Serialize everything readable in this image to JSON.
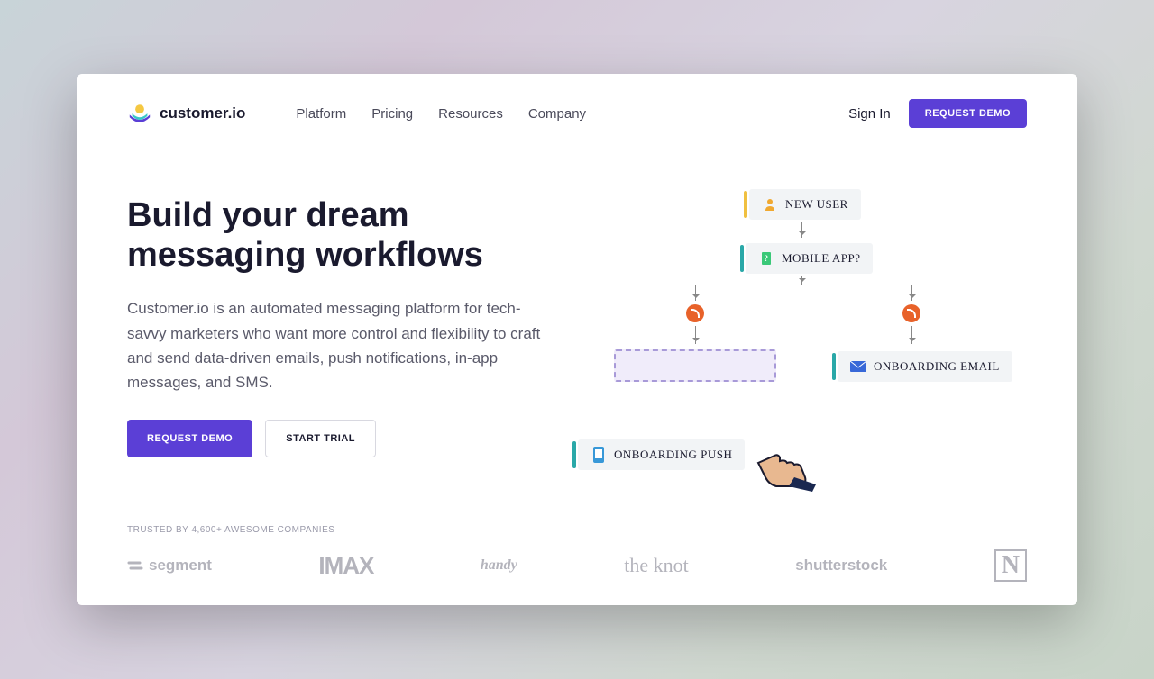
{
  "brand": {
    "name": "customer.io"
  },
  "nav": {
    "items": [
      "Platform",
      "Pricing",
      "Resources",
      "Company"
    ]
  },
  "header": {
    "signin": "Sign In",
    "request_demo": "REQUEST DEMO"
  },
  "hero": {
    "headline_line1": "Build your dream",
    "headline_line2": "messaging workflows",
    "subhead": "Customer.io is an automated messaging platform for tech-savvy marketers who want more control and flexibility to craft and send data-driven emails, push notifications, in-app messages, and SMS.",
    "cta_primary": "REQUEST DEMO",
    "cta_secondary": "START TRIAL"
  },
  "diagram": {
    "nodes": {
      "new_user": "NEW USER",
      "mobile_app": "MOBILE APP?",
      "onboarding_email": "ONBOARDING EMAIL",
      "onboarding_push": "ONBOARDING PUSH"
    }
  },
  "trusted": {
    "label": "TRUSTED BY 4,600+ AWESOME COMPANIES",
    "companies": [
      "segment",
      "IMAX",
      "handy",
      "the knot",
      "shutterstock",
      "N"
    ]
  },
  "colors": {
    "primary": "#5b3fd6",
    "accent_yellow": "#f0c040",
    "accent_teal": "#2aa8a8",
    "accent_orange": "#e8622a"
  }
}
